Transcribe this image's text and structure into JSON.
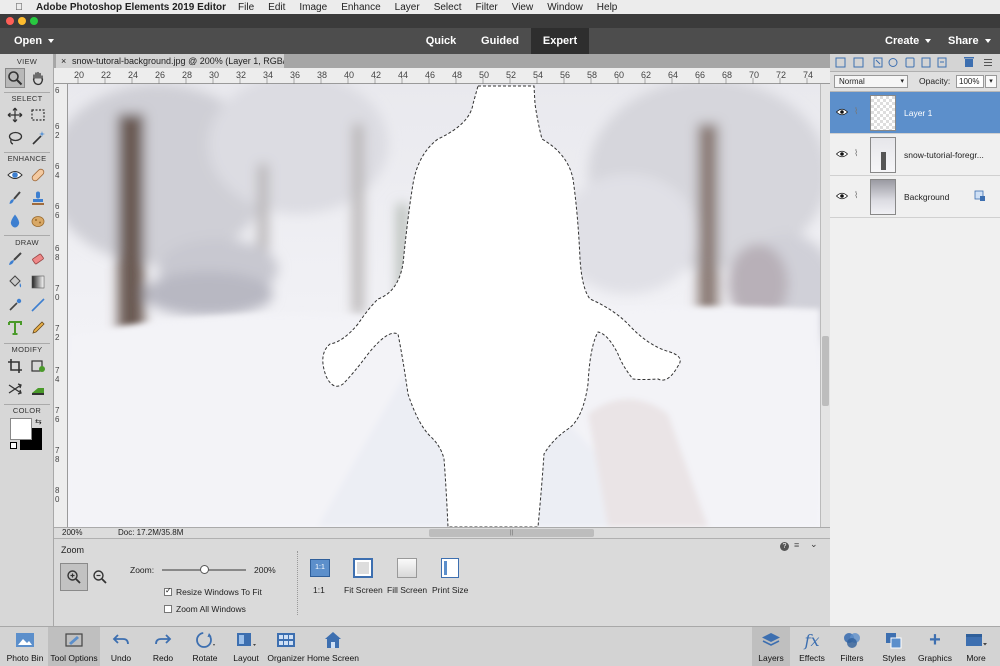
{
  "menubar": {
    "app_name": "Adobe Photoshop Elements 2019 Editor",
    "items": [
      "File",
      "Edit",
      "Image",
      "Enhance",
      "Layer",
      "Select",
      "Filter",
      "View",
      "Window",
      "Help"
    ]
  },
  "modebar": {
    "open_label": "Open",
    "tabs": [
      "Quick",
      "Guided",
      "Expert"
    ],
    "active_tab": "Expert",
    "create_label": "Create",
    "share_label": "Share"
  },
  "toolbox": {
    "sections": [
      "VIEW",
      "SELECT",
      "ENHANCE",
      "DRAW",
      "MODIFY",
      "COLOR"
    ]
  },
  "document": {
    "tab_title": "snow-tutoral-background.jpg @ 200% (Layer 1, RGB/8) *",
    "ruler_top": [
      "20",
      "22",
      "24",
      "26",
      "28",
      "30",
      "32",
      "34",
      "36",
      "38",
      "40",
      "42",
      "44",
      "46",
      "48",
      "50",
      "52",
      "54",
      "56",
      "58",
      "60",
      "62",
      "64",
      "66",
      "68",
      "70",
      "72",
      "74"
    ],
    "ruler_left": [
      "6",
      "6 2",
      "6 4",
      "6 6",
      "6 8",
      "7 0",
      "7 2",
      "7 4",
      "7 6",
      "7 8",
      "8 0"
    ],
    "zoom_status": "200%",
    "doc_status": "Doc: 17.2M/35.8M"
  },
  "tool_options": {
    "title": "Zoom",
    "zoom_label": "Zoom:",
    "zoom_value": "200%",
    "zoom_level": 0.5,
    "resize_windows_label": "Resize Windows To Fit",
    "resize_windows_checked": true,
    "zoom_all_label": "Zoom All Windows",
    "zoom_all_checked": false,
    "view_buttons": [
      "1:1",
      "Fit Screen",
      "Fill Screen",
      "Print Size"
    ],
    "one_to_one_icon_text": "1:1"
  },
  "layers_panel": {
    "blend_mode": "Normal",
    "opacity_label": "Opacity:",
    "opacity_value": "100%",
    "layers": [
      {
        "name": "Layer 1",
        "selected": true
      },
      {
        "name": "snow-tutorial-foregr...",
        "selected": false
      },
      {
        "name": "Background",
        "selected": false
      }
    ]
  },
  "bottombar": {
    "left": [
      "Photo Bin",
      "Tool Options",
      "Undo",
      "Redo",
      "Rotate",
      "Layout",
      "Organizer",
      "Home Screen"
    ],
    "right": [
      "Layers",
      "Effects",
      "Filters",
      "Styles",
      "Graphics",
      "More"
    ]
  },
  "colors": {
    "accent_blue": "#5c8fcb",
    "mode_bar": "#4d4d4d",
    "panel_gray": "#d7d7d7"
  }
}
